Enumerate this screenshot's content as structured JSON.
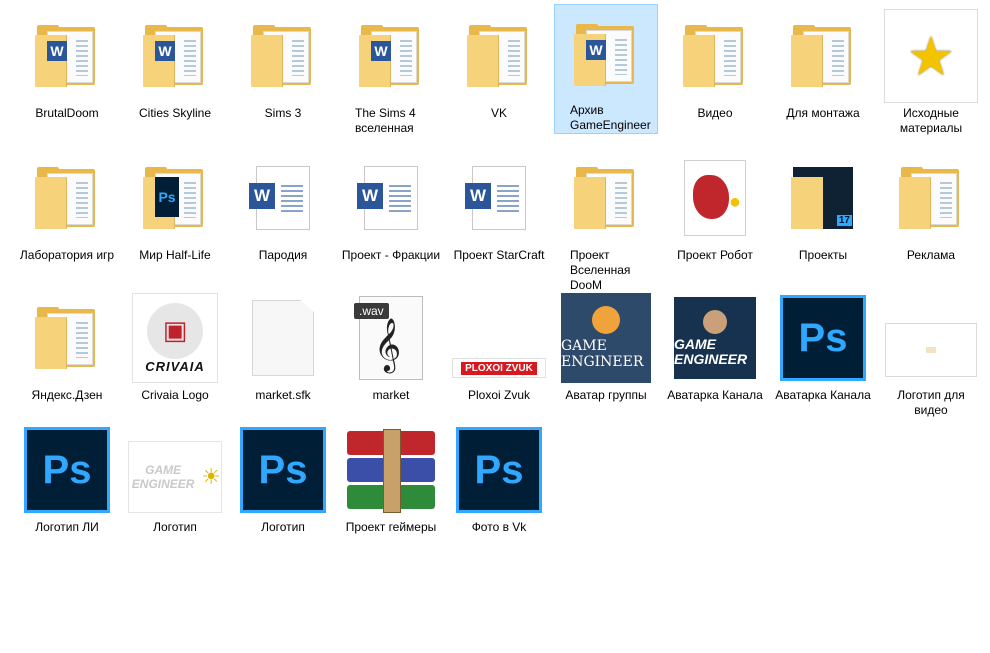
{
  "items": [
    {
      "label": "BrutalDoom",
      "icon": "word-folder-icon"
    },
    {
      "label": "Cities Skyline",
      "icon": "word-folder-icon"
    },
    {
      "label": "Sims 3",
      "icon": "folder-icon"
    },
    {
      "label": "The Sims 4 вселенная",
      "icon": "word-folder-icon"
    },
    {
      "label": "VK",
      "icon": "folder-icon"
    },
    {
      "label": "Архив GameEngineer",
      "icon": "word-folder-icon",
      "selected": true
    },
    {
      "label": "Видео",
      "icon": "folder-icon"
    },
    {
      "label": "Для монтажа",
      "icon": "folder-icon"
    },
    {
      "label": "Исходные материалы",
      "icon": "star-icon"
    },
    {
      "label": "Лаборатория игр",
      "icon": "folder-icon"
    },
    {
      "label": "Мир Half-Life",
      "icon": "ps-folder-icon"
    },
    {
      "label": "Пародия",
      "icon": "word-document-icon"
    },
    {
      "label": "Проект - Фракции",
      "icon": "word-document-icon"
    },
    {
      "label": "Проект StarCraft",
      "icon": "word-document-icon"
    },
    {
      "label": "Проект Вселенная DooM",
      "icon": "folder-icon"
    },
    {
      "label": "Проект Робот",
      "icon": "image-thumbnail-icon"
    },
    {
      "label": "Проекты",
      "icon": "dark-folder-icon"
    },
    {
      "label": "Реклама",
      "icon": "folder-icon"
    },
    {
      "label": "Яндекс.Дзен",
      "icon": "folder-icon"
    },
    {
      "label": "Crivaia Logo",
      "icon": "crivaia-thumbnail",
      "thumb_text": "CRIVAIA"
    },
    {
      "label": "market.sfk",
      "icon": "blank-file-icon"
    },
    {
      "label": "market",
      "icon": "wav-file-icon",
      "thumb_text": ".wav"
    },
    {
      "label": "Ploxoi Zvuk",
      "icon": "ploxoi-thumbnail",
      "thumb_text": "PLOXOI ZVUK"
    },
    {
      "label": "Аватар группы",
      "icon": "game-engineer-avatar",
      "thumb_text": "GAME ENGINEER"
    },
    {
      "label": "Аватарка Канала",
      "icon": "game-engineer-channel",
      "thumb_text": "GAME ENGINEER"
    },
    {
      "label": "Аватарка Канала",
      "icon": "photoshop-file-icon",
      "thumb_text": "Ps"
    },
    {
      "label": "Логотип для видео",
      "icon": "logo-video-thumbnail"
    },
    {
      "label": "Логотип ЛИ",
      "icon": "photoshop-file-icon",
      "thumb_text": "Ps"
    },
    {
      "label": "Логотип",
      "icon": "game-engineer-logo",
      "thumb_text": "GAME ENGINEER"
    },
    {
      "label": "Логотип",
      "icon": "photoshop-file-icon",
      "thumb_text": "Ps"
    },
    {
      "label": "Проект геймеры",
      "icon": "winrar-archive-icon"
    },
    {
      "label": "Фото в Vk",
      "icon": "photoshop-file-icon",
      "thumb_text": "Ps"
    }
  ],
  "colors": {
    "selection_bg": "#cce8ff",
    "selection_border": "#99d1ff",
    "folder": "#f6d27a",
    "word_blue": "#2b579a",
    "ps_blue": "#31a8ff",
    "ps_dark": "#001e36"
  }
}
